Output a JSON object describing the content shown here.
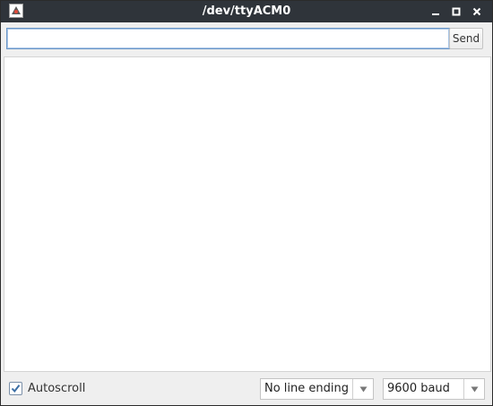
{
  "window": {
    "title": "/dev/ttyACM0"
  },
  "send": {
    "input_value": "",
    "button_label": "Send"
  },
  "output": {
    "text": ""
  },
  "footer": {
    "autoscroll_label": "Autoscroll",
    "autoscroll_checked": true,
    "line_ending": "No line ending",
    "baud_rate": "9600 baud"
  },
  "colors": {
    "titlebar": "#2f343a",
    "focus_border": "#6b97c8",
    "checkmark": "#3b6ea5"
  }
}
